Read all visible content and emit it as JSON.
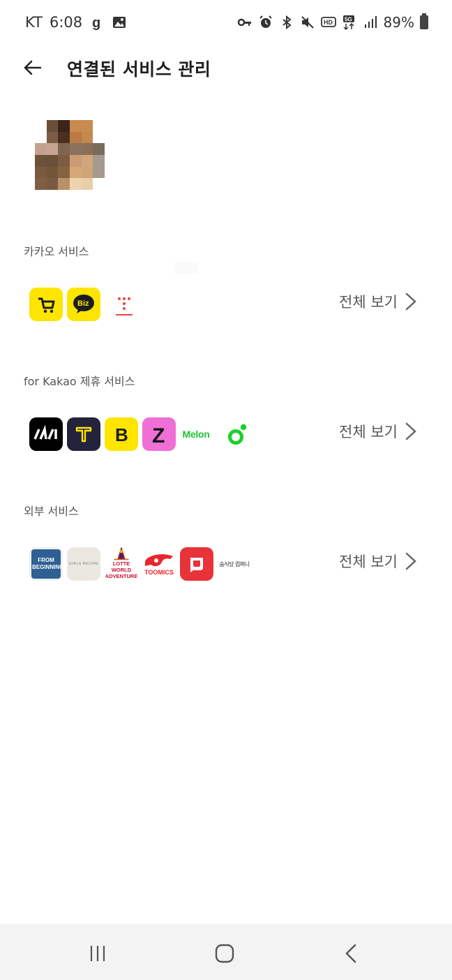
{
  "status_bar": {
    "carrier": "KT",
    "time": "6:08",
    "battery": "89%",
    "left_icons": [
      "g-app-icon",
      "gallery-icon"
    ],
    "right_icons": [
      "key-icon",
      "alarm-icon",
      "bluetooth-icon",
      "mute-icon",
      "hd-icon",
      "5g-icon",
      "signal-icon",
      "battery-icon"
    ]
  },
  "header": {
    "title": "연결된 서비스 관리",
    "back_icon": "arrow-left-icon"
  },
  "sections": [
    {
      "label": "카카오 서비스",
      "view_all": "전체 보기",
      "icons": [
        "kakao-shopping-icon",
        "kakao-biz-icon",
        "kakao-t-dots-icon"
      ]
    },
    {
      "label": "for Kakao 제휴 서비스",
      "view_all": "전체 보기",
      "icons": [
        "kakao-sports-icon",
        "kakao-t-icon",
        "b-icon",
        "zigzag-icon",
        "melon-icon",
        "green-circle-icon"
      ],
      "melon_text": "Melon"
    },
    {
      "label": "외부 서비스",
      "view_all": "전체 보기",
      "icons": [
        "from-beginning-icon",
        "girls-recipe-icon",
        "lotte-world-icon",
        "toomics-icon",
        "red-chat-icon",
        "small-logo-icon"
      ],
      "from_beginning_text": "FROM BEGINNING.",
      "girls_recipe_text": "GIRLS RECIPE",
      "lotte_text": "LOTTE WORLD ADVENTURE",
      "toomics_text": "TOOMICS",
      "small_logo_text": "숨식당 컴퍼니"
    }
  ],
  "nav": {
    "recent": "recent-apps-icon",
    "home": "home-icon",
    "back": "back-icon"
  }
}
